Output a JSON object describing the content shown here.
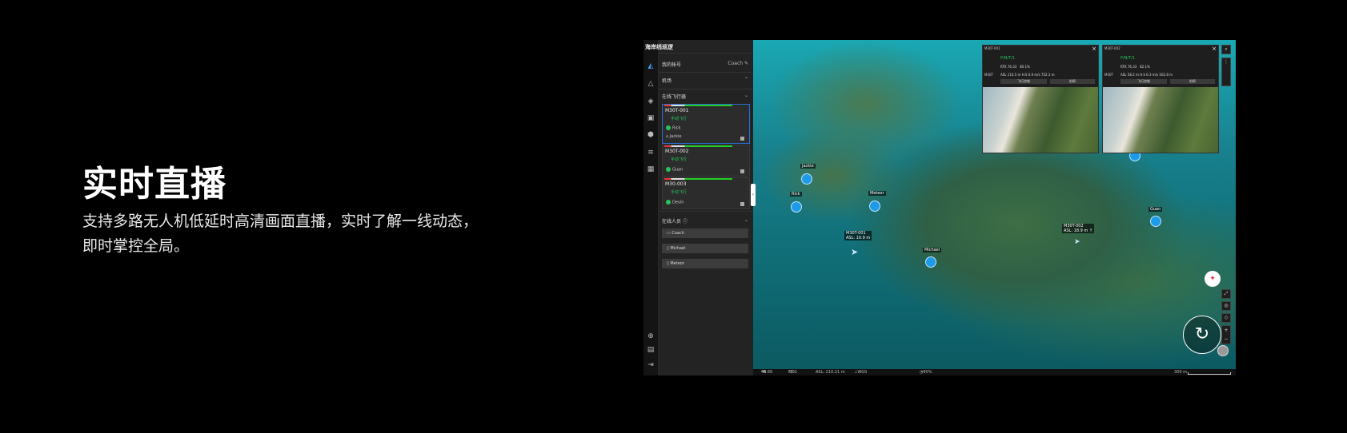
{
  "hero": {
    "title": "实时直播",
    "description_line1": "支持多路无人机低延时高清画面直播，实时了解一线动态，",
    "description_line2": "即时掌控全局。"
  },
  "app": {
    "project_title": "海岸线巡逻",
    "my_account_label": "我的帐号",
    "my_account_value": "Coach",
    "dock_section": "机场",
    "online_aircraft_section": "在线飞行器",
    "aircraft": [
      {
        "name": "M30T-001",
        "status": "手动飞行",
        "pilot": "Rick",
        "operator": "Jackie"
      },
      {
        "name": "M30T-002",
        "status": "手动飞行",
        "pilot": "Guan"
      },
      {
        "name": "M30-003",
        "status": "手动飞行",
        "pilot": "Devin"
      }
    ],
    "online_people_section": "在线人员",
    "people": [
      "Coach",
      "Michael",
      "Meteor"
    ],
    "bottom_bar": {
      "lat": "46.66",
      "lat_dir": "N",
      "lon": "6.91",
      "lon_dir": "E",
      "asl": "ASL: 210.21 m",
      "crs": "WGS 84 / UTM zone 32N",
      "zoom": "80%",
      "scale": "300 m"
    },
    "map_labels": {
      "jackie": "Jackie",
      "rick": "Rick",
      "meteor": "Meteor",
      "michael": "Michael",
      "guan": "Guan",
      "m30t001_tag": "M30T-001",
      "m30t001_asl": "ASL: 10.9 m",
      "m30t002_tag": "M30T-002",
      "m30t002_asl": "ASL: 18.9 m ↑"
    },
    "videos": [
      {
        "title": "M30T-001",
        "mode": "P/N/T/1",
        "rtk": "RTK 76.33",
        "battery": "80.1%",
        "asl": "ASL 110.5 m",
        "speed": "H.S 6.9 m/s",
        "dist": "752.3 m",
        "side": "M30T",
        "btn1": "飞行控制",
        "btn2": "拍照"
      },
      {
        "title": "M30T-002",
        "mode": "P/N/T/1",
        "rtk": "RTK 76.33",
        "battery": "82.1%",
        "asl": "ASL 58.2 m",
        "speed": "H.S 6.3 m/s",
        "dist": "502.8 m",
        "side": "M30T",
        "btn1": "飞行控制",
        "btn2": "拍照"
      }
    ],
    "icons": [
      "workspace-icon",
      "warning-icon",
      "layers-icon",
      "media-icon",
      "model-icon",
      "settings-icon",
      "calendar-icon",
      "globe-icon",
      "device-icon",
      "logout-icon"
    ]
  }
}
